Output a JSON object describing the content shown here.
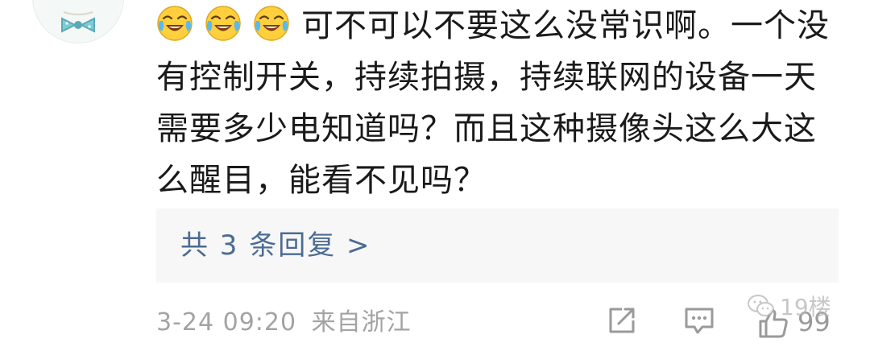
{
  "comment": {
    "emoji_icon": "laugh-cry-icon",
    "emoji_count": 3,
    "text": "可不可以不要这么没常识啊。一个没有控制开关，持续拍摄，持续联网的设备一天需要多少电知道吗？而且这种摄像头这么大这么醒目，能看不见吗？"
  },
  "replies": {
    "label": "共 3 条回复 >"
  },
  "meta": {
    "time": "3-24 09:20",
    "source": "来自浙江"
  },
  "actions": {
    "share_icon": "share-icon",
    "comment_icon": "comment-icon",
    "like_icon": "thumbs-up-icon",
    "like_count": "99"
  },
  "watermark": {
    "text": "19楼"
  },
  "colors": {
    "text": "#1a1a1a",
    "link": "#4b6b93",
    "meta": "#a3a3a3",
    "reply_bg": "#f7f7f7"
  }
}
